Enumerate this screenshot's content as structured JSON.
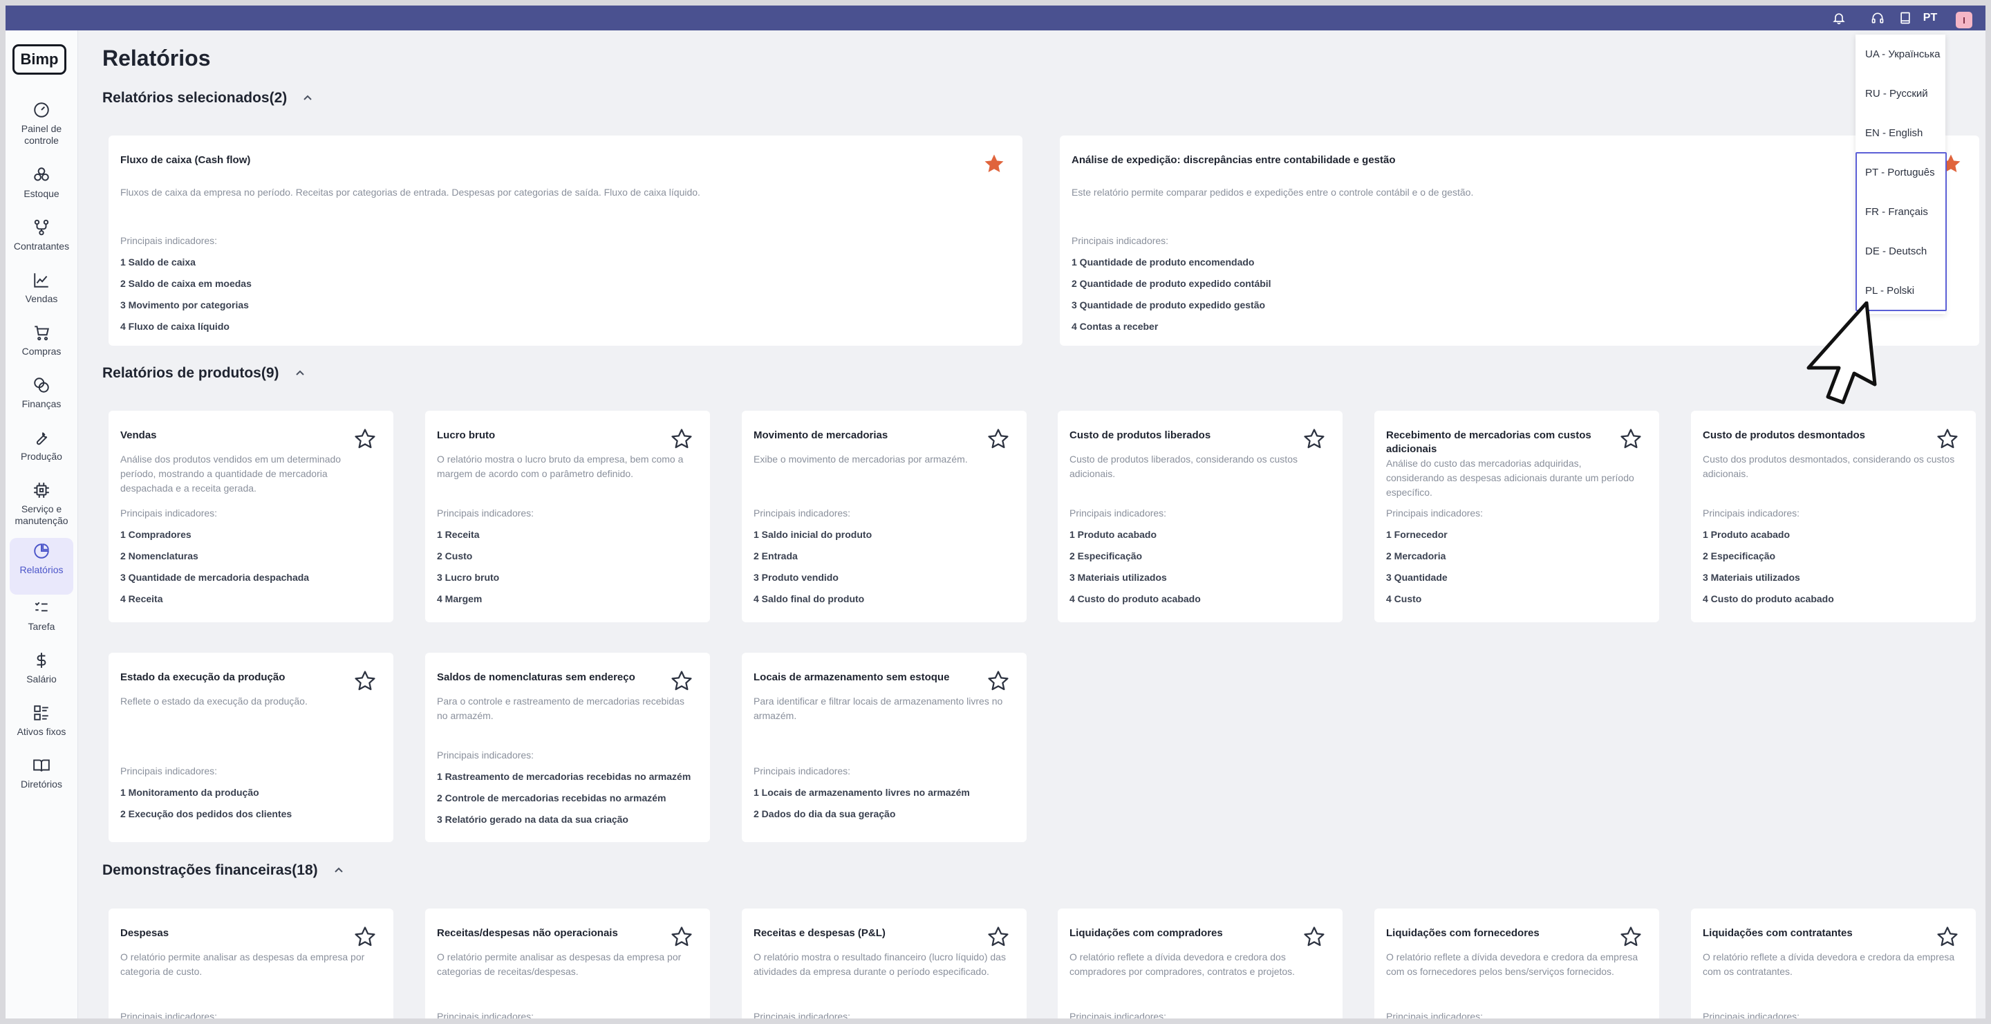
{
  "topbar": {
    "lang": "PT",
    "avatar_letter": "I",
    "icons": [
      "bell-icon",
      "headset-icon",
      "book-icon"
    ]
  },
  "sidebar": {
    "logo": "Bimp",
    "items": [
      {
        "label": "Painel de controle",
        "icon": "dashboard-icon"
      },
      {
        "label": "Estoque",
        "icon": "boxes-icon"
      },
      {
        "label": "Contratantes",
        "icon": "contractors-icon"
      },
      {
        "label": "Vendas",
        "icon": "chart-line-icon"
      },
      {
        "label": "Compras",
        "icon": "cart-icon"
      },
      {
        "label": "Finanças",
        "icon": "coins-icon"
      },
      {
        "label": "Produção",
        "icon": "wrench-icon"
      },
      {
        "label": "Serviço e manutenção",
        "icon": "chip-icon"
      },
      {
        "label": "Relatórios",
        "icon": "pie-chart-icon",
        "active": true
      },
      {
        "label": "Tarefa",
        "icon": "task-list-icon"
      },
      {
        "label": "Salário",
        "icon": "dollar-icon"
      },
      {
        "label": "Ativos fixos",
        "icon": "assets-icon"
      },
      {
        "label": "Diretórios",
        "icon": "open-book-icon"
      }
    ]
  },
  "page": {
    "title": "Relatórios",
    "sections": {
      "selected": "Relatórios selecionados(2)",
      "products": "Relatórios de produtos(9)",
      "financial": "Demonstrações financeiras(18)"
    },
    "indicators_label": "Principais indicadores:"
  },
  "selected_cards": [
    {
      "title": "Fluxo de caixa (Cash flow)",
      "desc": "Fluxos de caixa da empresa no período. Receitas por categorias de entrada. Despesas por categorias de saída. Fluxo de caixa líquido.",
      "indicators": [
        "1 Saldo de caixa",
        "2 Saldo de caixa em moedas",
        "3 Movimento por categorias",
        "4 Fluxo de caixa líquido"
      ],
      "starred": true
    },
    {
      "title": "Análise de expedição: discrepâncias entre contabilidade e gestão",
      "desc": "Este relatório permite comparar pedidos e expedições entre o controle contábil e o de gestão.",
      "indicators": [
        "1 Quantidade de produto encomendado",
        "2 Quantidade de produto expedido contábil",
        "3 Quantidade de produto expedido gestão",
        "4 Contas a receber"
      ],
      "starred": true
    }
  ],
  "product_cards": [
    {
      "title": "Vendas",
      "desc": "Análise dos produtos vendidos em um determinado período, mostrando a quantidade de mercadoria despachada e a receita gerada.",
      "indicators": [
        "1 Compradores",
        "2 Nomenclaturas",
        "3 Quantidade de mercadoria despachada",
        "4 Receita"
      ]
    },
    {
      "title": "Lucro bruto",
      "desc": "O relatório mostra o lucro bruto da empresa, bem como a margem de acordo com o parâmetro definido.",
      "indicators": [
        "1 Receita",
        "2 Custo",
        "3 Lucro bruto",
        "4 Margem"
      ]
    },
    {
      "title": "Movimento de mercadorias",
      "desc": "Exibe o movimento de mercadorias por armazém.",
      "indicators": [
        "1 Saldo inicial do produto",
        "2 Entrada",
        "3 Produto vendido",
        "4 Saldo final do produto"
      ]
    },
    {
      "title": "Custo de produtos liberados",
      "desc": "Custo de produtos liberados, considerando os custos adicionais.",
      "indicators": [
        "1 Produto acabado",
        "2 Especificação",
        "3 Materiais utilizados",
        "4 Custo do produto acabado"
      ]
    },
    {
      "title": "Recebimento de mercadorias com custos adicionais",
      "desc": "Análise do custo das mercadorias adquiridas, considerando as despesas adicionais durante um período específico.",
      "indicators": [
        "1 Fornecedor",
        "2 Mercadoria",
        "3 Quantidade",
        "4 Custo"
      ]
    },
    {
      "title": "Custo de produtos desmontados",
      "desc": "Custo dos produtos desmontados, considerando os custos adicionais.",
      "indicators": [
        "1 Produto acabado",
        "2 Especificação",
        "3 Materiais utilizados",
        "4 Custo do produto acabado"
      ]
    },
    {
      "title": "Estado da execução da produção",
      "desc": "Reflete o estado da execução da produção.",
      "indicators": [
        "1 Monitoramento da produção",
        "2 Execução dos pedidos dos clientes"
      ]
    },
    {
      "title": "Saldos de nomenclaturas sem endereço",
      "desc": "Para o controle e rastreamento de mercadorias recebidas no armazém.",
      "indicators": [
        "1 Rastreamento de mercadorias recebidas no armazém",
        "2 Controle de mercadorias recebidas no armazém",
        "3 Relatório gerado na data da sua criação"
      ]
    },
    {
      "title": "Locais de armazenamento sem estoque",
      "desc": "Para identificar e filtrar locais de armazenamento livres no armazém.",
      "indicators": [
        "1 Locais de armazenamento livres no armazém",
        "2 Dados do dia da sua geração"
      ]
    }
  ],
  "financial_cards": [
    {
      "title": "Despesas",
      "desc": "O relatório permite analisar as despesas da empresa por categoria de custo."
    },
    {
      "title": "Receitas/despesas não operacionais",
      "desc": "O relatório permite analisar as despesas da empresa por categorias de receitas/despesas."
    },
    {
      "title": "Receitas e despesas (P&L)",
      "desc": "O relatório mostra o resultado financeiro (lucro líquido) das atividades da empresa durante o período especificado."
    },
    {
      "title": "Liquidações com compradores",
      "desc": "O relatório reflete a dívida devedora e credora dos compradores por compradores, contratos e projetos."
    },
    {
      "title": "Liquidações com fornecedores",
      "desc": "O relatório reflete a dívida devedora e credora da empresa com os fornecedores pelos bens/serviços fornecidos."
    },
    {
      "title": "Liquidações com contratantes",
      "desc": "O relatório reflete a dívida devedora e credora da empresa com os contratantes."
    }
  ],
  "language_menu": {
    "options": [
      "UA - Українська",
      "RU - Русский",
      "EN - English",
      "PT - Português",
      "FR - Français",
      "DE - Deutsch",
      "PL - Polski"
    ],
    "selected": "PT - Português"
  },
  "colors": {
    "topbar": "#4a5190",
    "accent": "#4b55c9",
    "star_filled": "#e0643c"
  }
}
